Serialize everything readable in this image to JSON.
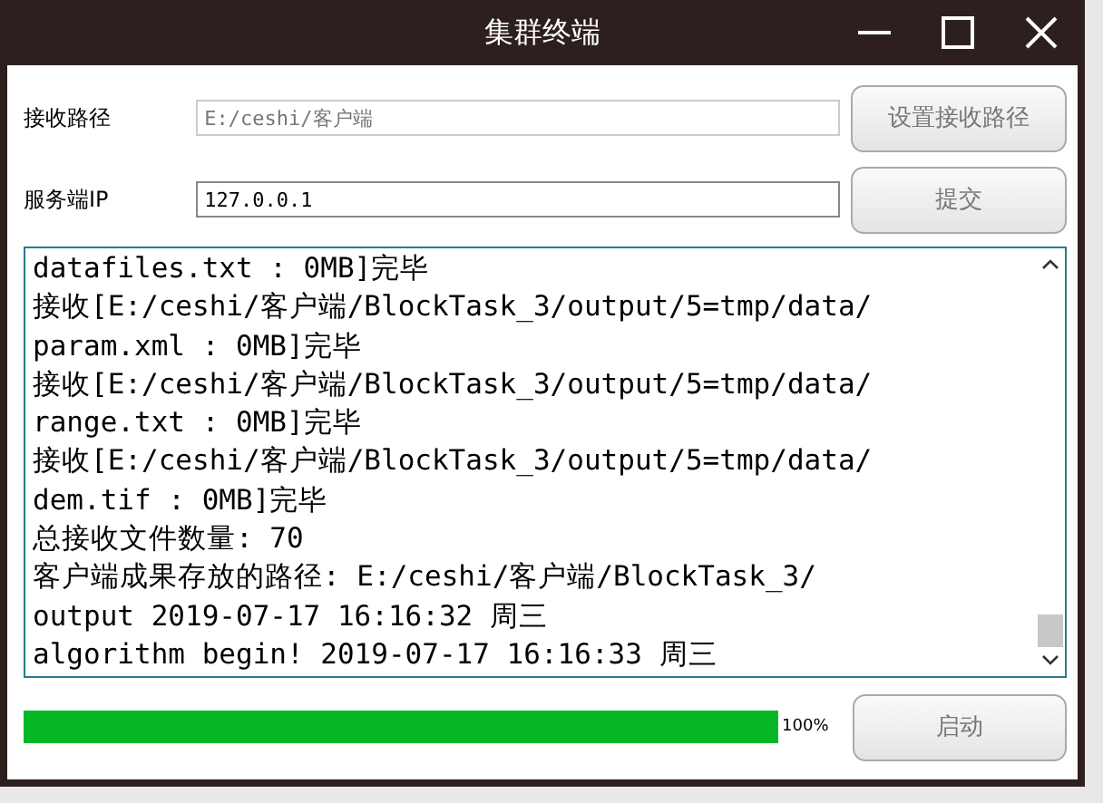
{
  "window": {
    "title": "集群终端"
  },
  "fields": [
    {
      "label": "接收路径",
      "value": "E:/ceshi/客户端",
      "disabled": true,
      "button": "设置接收路径"
    },
    {
      "label": "服务端IP",
      "value": "127.0.0.1",
      "disabled": false,
      "button": "提交"
    }
  ],
  "log": [
    "datafiles.txt : 0MB]完毕",
    "接收[E:/ceshi/客户端/BlockTask_3/output/5=tmp/data/",
    "param.xml : 0MB]完毕",
    "接收[E:/ceshi/客户端/BlockTask_3/output/5=tmp/data/",
    "range.txt : 0MB]完毕",
    "接收[E:/ceshi/客户端/BlockTask_3/output/5=tmp/data/",
    "dem.tif : 0MB]完毕",
    "总接收文件数量: 70",
    "客户端成果存放的路径: E:/ceshi/客户端/BlockTask_3/",
    "output 2019-07-17 16:16:32 周三",
    "algorithm begin! 2019-07-17 16:16:33 周三"
  ],
  "progress": {
    "level": 1,
    "reading": "100%"
  },
  "start_button": "启动"
}
